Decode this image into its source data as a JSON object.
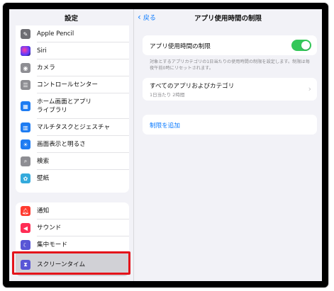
{
  "sidebar": {
    "title": "設定",
    "group1": [
      {
        "label": "Apple Pencil",
        "icon": "pencil-icon",
        "color": "#6e6e73"
      },
      {
        "label": "Siri",
        "icon": "siri-icon",
        "color": "#2b2b6e"
      },
      {
        "label": "カメラ",
        "icon": "camera-icon",
        "color": "#8e8e93"
      },
      {
        "label": "コントロールセンター",
        "icon": "control-center-icon",
        "color": "#8e8e93"
      },
      {
        "label": "ホーム画面とアプリライブラリ",
        "line1": "ホーム画面とアプリ",
        "line2": "ライブラリ",
        "icon": "home-screen-icon",
        "color": "#1e7cf2"
      },
      {
        "label": "マルチタスクとジェスチャ",
        "icon": "multitask-icon",
        "color": "#1e7cf2"
      },
      {
        "label": "画面表示と明るさ",
        "icon": "brightness-icon",
        "color": "#1e7cf2"
      },
      {
        "label": "検索",
        "icon": "search-icon",
        "color": "#8e8e93"
      },
      {
        "label": "壁紙",
        "icon": "wallpaper-icon",
        "color": "#34aadc"
      }
    ],
    "group2": [
      {
        "label": "通知",
        "icon": "notifications-icon",
        "color": "#ff3b30"
      },
      {
        "label": "サウンド",
        "icon": "sound-icon",
        "color": "#ff2d55"
      },
      {
        "label": "集中モード",
        "icon": "focus-icon",
        "color": "#5856d6"
      },
      {
        "label": "スクリーンタイム",
        "icon": "hourglass-icon",
        "color": "#5856d6"
      }
    ]
  },
  "main": {
    "back_label": "戻る",
    "title": "アプリ使用時間の制限",
    "toggle_label": "アプリ使用時間の制限",
    "toggle_on": true,
    "note": "対象とするアプリカテゴリの1日当たりの使用時間の制限を設定します。制限は毎夜午前0時にリセットされます。",
    "limit_title": "すべてのアプリおよびカテゴリ",
    "limit_sub": "1日当たり 2時間",
    "add_limit": "制限を追加",
    "accent": "#0a7aff",
    "toggle_color": "#34c759"
  }
}
